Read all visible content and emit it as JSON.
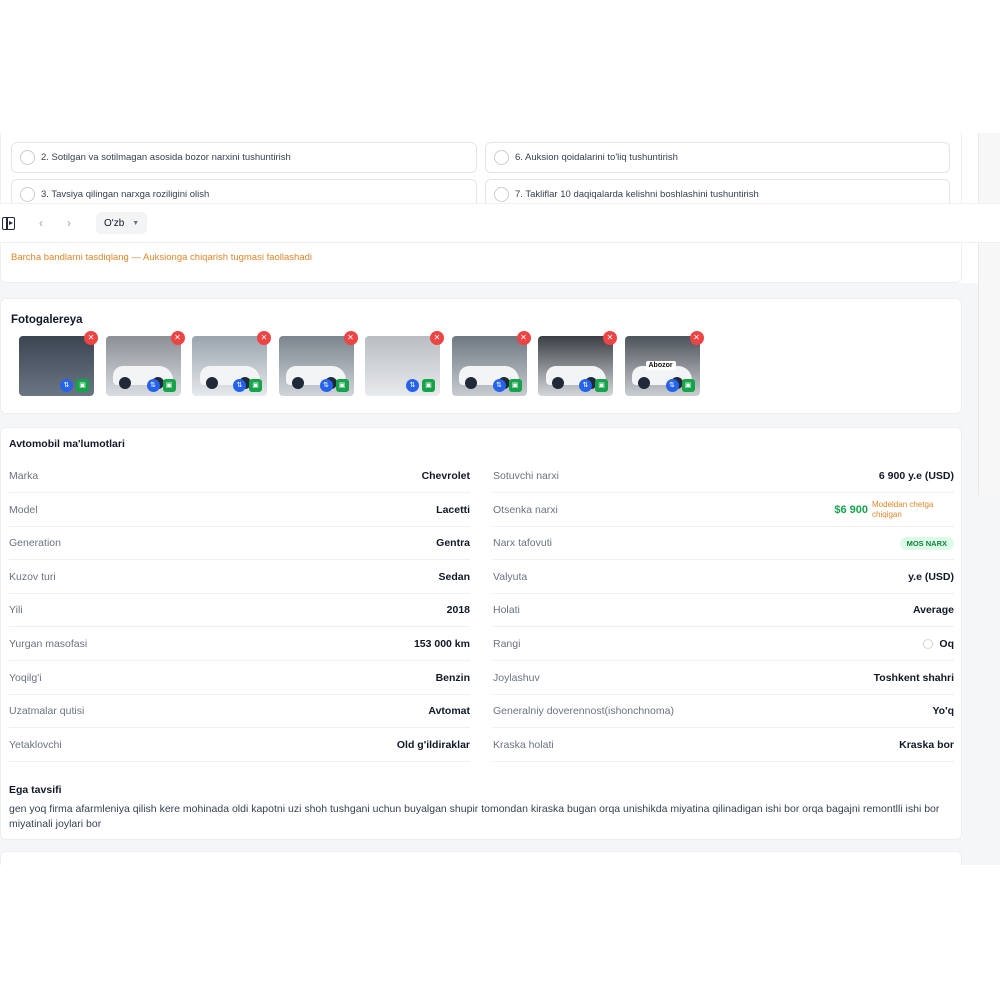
{
  "checklist": {
    "items": [
      {
        "label": "2. Sotilgan va sotilmagan asosida bozor narxini tushuntirish"
      },
      {
        "label": "6. Auksion qoidalarini to'liq tushuntirish"
      },
      {
        "label": "3. Tavsiya qilingan narxga roziligini olish"
      },
      {
        "label": "7. Takliflar 10 daqiqalarda kelishni boshlashini tushuntirish"
      }
    ],
    "warning": "Barcha bandlarni tasdiqlang — Auksionga chiqarish tugmasi faollashadi"
  },
  "toolbar": {
    "language": "O'zb",
    "icons": [
      "sidebar-toggle-icon",
      "chevron-left-icon",
      "chevron-right-icon",
      "chevron-down-icon"
    ]
  },
  "gallery": {
    "title": "Fotogalereya",
    "photos": [
      {
        "tag": ""
      },
      {
        "tag": ""
      },
      {
        "tag": ""
      },
      {
        "tag": ""
      },
      {
        "tag": ""
      },
      {
        "tag": ""
      },
      {
        "tag": ""
      },
      {
        "tag": "Abozor"
      }
    ]
  },
  "info": {
    "title": "Avtomobil ma'lumotlari",
    "left": [
      {
        "label": "Marka",
        "value": "Chevrolet"
      },
      {
        "label": "Model",
        "value": "Lacetti"
      },
      {
        "label": "Generation",
        "value": "Gentra"
      },
      {
        "label": "Kuzov turi",
        "value": "Sedan"
      },
      {
        "label": "Yili",
        "value": "2018"
      },
      {
        "label": "Yurgan masofasi",
        "value": "153 000 km"
      },
      {
        "label": "Yoqilg'i",
        "value": "Benzin"
      },
      {
        "label": "Uzatmalar qutisi",
        "value": "Avtomat"
      },
      {
        "label": "Yetaklovchi",
        "value": "Old g'ildiraklar"
      }
    ],
    "right": [
      {
        "label": "Sotuvchi narxi",
        "value": "6 900 y.e (USD)"
      },
      {
        "label": "Otsenka narxi",
        "value": "$6 900",
        "note": "Modeldan chetga chiqigan"
      },
      {
        "label": "Narx tafovuti",
        "value": "MOS NARX"
      },
      {
        "label": "Valyuta",
        "value": "y.e (USD)"
      },
      {
        "label": "Holati",
        "value": "Average"
      },
      {
        "label": "Rangi",
        "value": "Oq"
      },
      {
        "label": "Joylashuv",
        "value": "Toshkent shahri"
      },
      {
        "label": "Generalniy doverennost(ishonchnoma)",
        "value": "Yo'q"
      },
      {
        "label": "Kraska holati",
        "value": "Kraska bor"
      }
    ],
    "owner_title": "Ega tavsifi",
    "owner_text": "gen yoq firma afarmleniya qilish kere mohinada oldi kapotni uzi shoh tushgani uchun buyalgan shupir tomondan kiraska bugan orqa unishikda miyatina qilinadigan ishi bor orqa bagajni remontlli ishi bor miyatinali joylari bor"
  },
  "colors": {
    "accent_green": "#16a34a",
    "warning_orange": "#e0862b",
    "delete_red": "#ef4444",
    "action_blue": "#2563eb"
  }
}
